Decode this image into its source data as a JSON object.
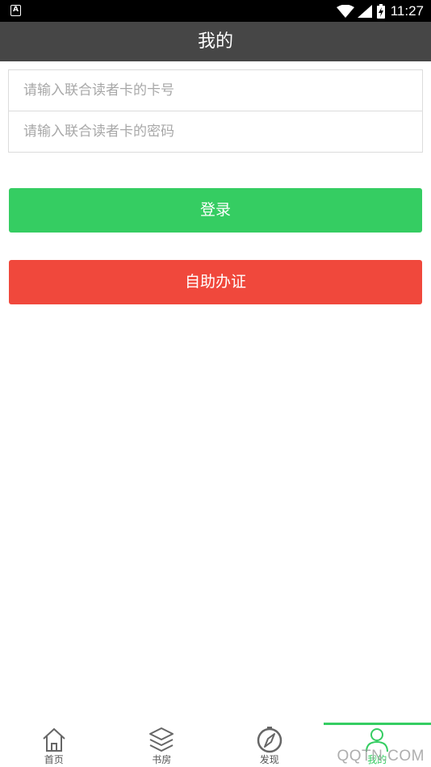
{
  "status_bar": {
    "app_icon": "A",
    "time": "11:27",
    "icons": [
      "wifi-icon",
      "signal-icon",
      "battery-icon"
    ]
  },
  "header": {
    "title": "我的"
  },
  "login": {
    "card_number_placeholder": "请输入联合读者卡的卡号",
    "password_placeholder": "请输入联合读者卡的密码",
    "login_label": "登录",
    "self_register_label": "自助办证"
  },
  "tabs": [
    {
      "label": "首页",
      "icon": "home-icon",
      "active": false
    },
    {
      "label": "书房",
      "icon": "layers-icon",
      "active": false
    },
    {
      "label": "发现",
      "icon": "compass-icon",
      "active": false
    },
    {
      "label": "我的",
      "icon": "person-icon",
      "active": true
    }
  ],
  "watermark": "QQTN.COM",
  "colors": {
    "login_button": "#35cd62",
    "register_button": "#f0483c",
    "title_bar": "#464646",
    "active_tab": "#35cd62"
  }
}
